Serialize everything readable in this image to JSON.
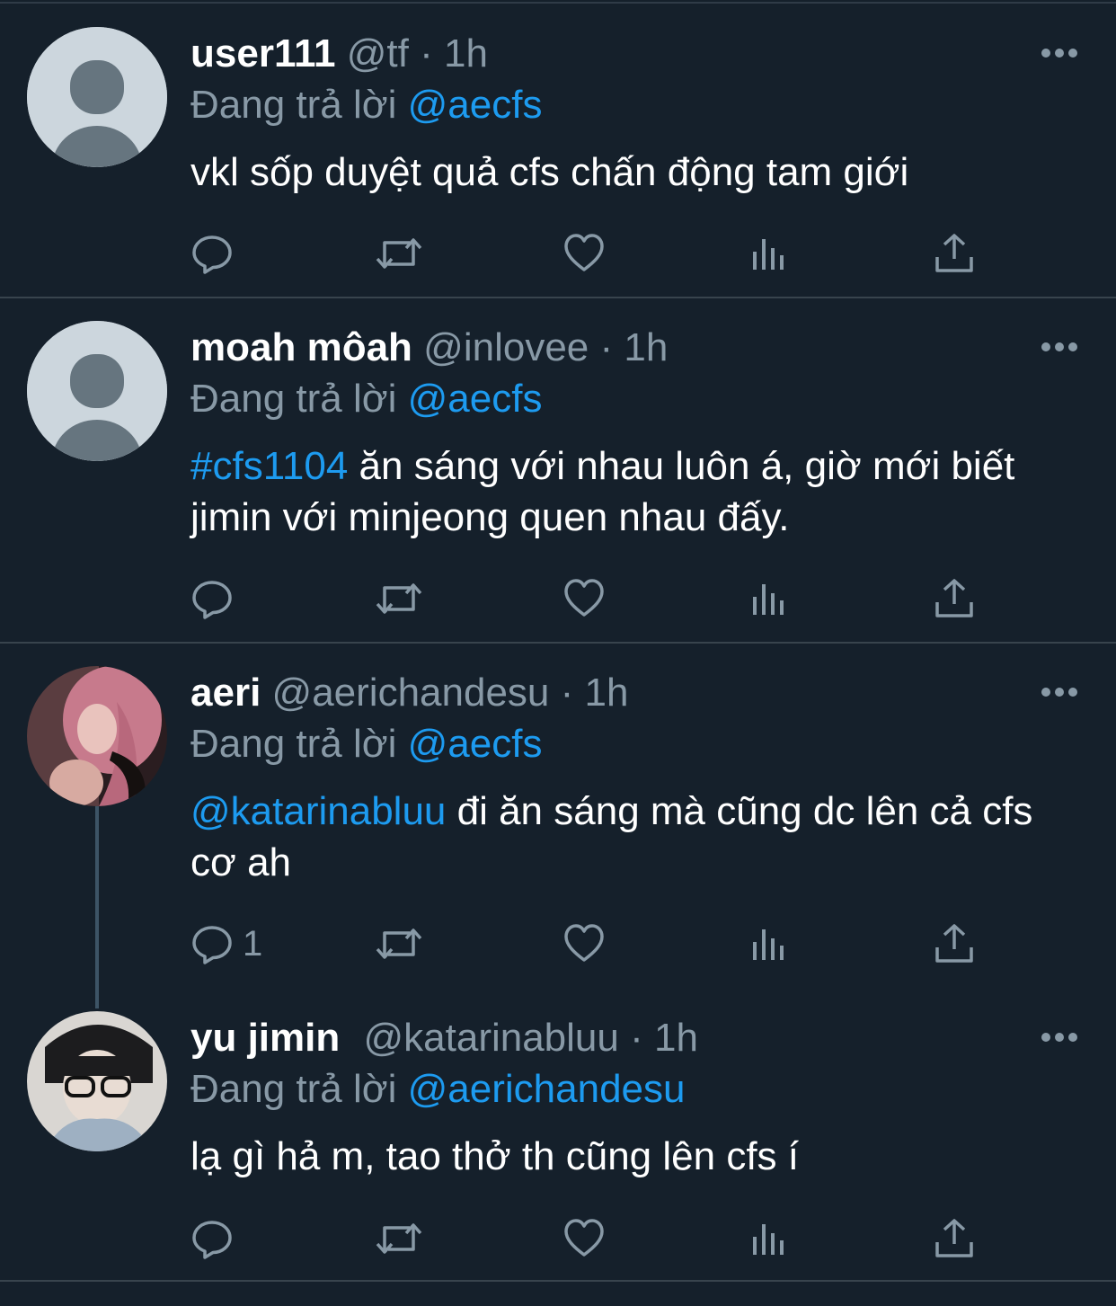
{
  "tweets": [
    {
      "name": "user111",
      "handle": "@tf",
      "sep": "·",
      "time": "1h",
      "reply_prefix": "Đang trả lời",
      "reply_to": "@aecfs",
      "text": "vkl sốp duyệt quả cfs chấn động tam giới",
      "avatar": "default-avatar",
      "reply_count": ""
    },
    {
      "name": "moah môah",
      "handle": "@inlovee",
      "sep": "·",
      "time": "1h",
      "reply_prefix": "Đang trả lời",
      "reply_to": "@aecfs",
      "text_link": "#cfs1104",
      "text": " ăn sáng với nhau luôn á, giờ mới biết jimin với minjeong quen nhau đấy.",
      "avatar": "default-avatar",
      "reply_count": ""
    },
    {
      "name": "aeri",
      "handle": "@aerichandesu",
      "sep": "·",
      "time": "1h",
      "reply_prefix": "Đang trả lời",
      "reply_to": "@aecfs",
      "text_link": "@katarinabluu",
      "text": " đi ăn sáng mà cũng dc lên cả cfs cơ ah",
      "avatar": "photo-avatar-pink-hair",
      "reply_count": "1"
    },
    {
      "name": "yu jimin",
      "handle": "@katarinabluu",
      "sep": "·",
      "time": "1h",
      "reply_prefix": "Đang trả lời",
      "reply_to": "@aerichandesu",
      "text": "lạ gì hả m, tao thở th cũng lên cfs í",
      "avatar": "photo-avatar-glasses",
      "reply_count": ""
    }
  ],
  "colors": {
    "background": "#15202b",
    "text": "#ffffff",
    "secondary": "#8899a6",
    "link": "#1d9bf0",
    "divider": "#38444d"
  },
  "icons": [
    "reply-icon",
    "retweet-icon",
    "like-icon",
    "views-icon",
    "share-icon",
    "more-icon"
  ]
}
